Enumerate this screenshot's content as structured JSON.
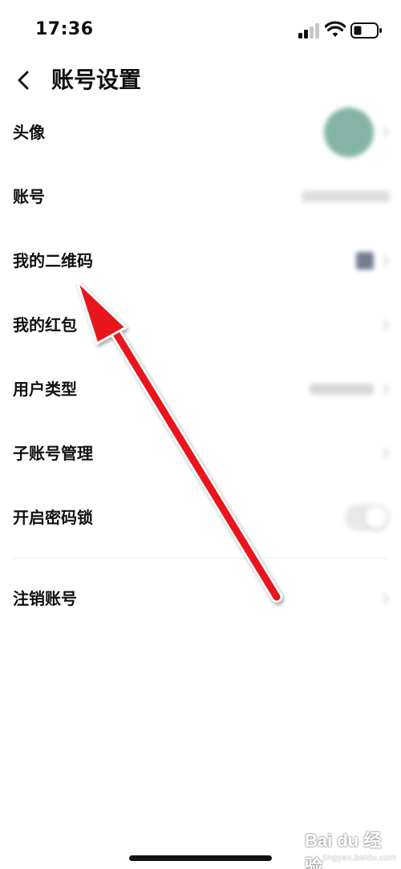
{
  "status_bar": {
    "time": "17:36"
  },
  "nav": {
    "title": "账号设置",
    "back_icon": "chevron-left-icon"
  },
  "settings": {
    "items": [
      {
        "label": "头像"
      },
      {
        "label": "账号"
      },
      {
        "label": "我的二维码"
      },
      {
        "label": "我的红包"
      },
      {
        "label": "用户类型"
      },
      {
        "label": "子账号管理"
      },
      {
        "label": "开启密码锁"
      },
      {
        "label": "注销账号"
      }
    ]
  },
  "watermark": {
    "main": "Bai du 经验",
    "sub": "jingyan.baidu.com"
  },
  "colors": {
    "arrow": "#e8141c",
    "avatar": "#6fa896",
    "text": "#111111"
  }
}
